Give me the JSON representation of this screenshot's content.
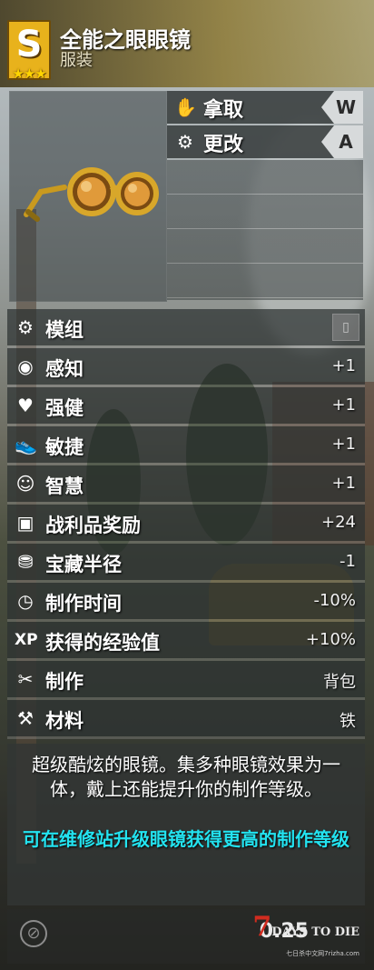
{
  "item": {
    "tier_letter": "S",
    "tier_stars": "★★★",
    "name": "全能之眼眼镜",
    "category": "服装"
  },
  "actions": [
    {
      "label": "拿取",
      "key": "W",
      "icon": "hand-grab-icon"
    },
    {
      "label": "更改",
      "key": "A",
      "icon": "gears-icon"
    }
  ],
  "stats": [
    {
      "label": "模组",
      "value": "",
      "icon": "gear-icon"
    },
    {
      "label": "感知",
      "value": "+1",
      "icon": "eye-icon"
    },
    {
      "label": "强健",
      "value": "+1",
      "icon": "heart-icon"
    },
    {
      "label": "敏捷",
      "value": "+1",
      "icon": "shoe-icon"
    },
    {
      "label": "智慧",
      "value": "+1",
      "icon": "brain-icon"
    },
    {
      "label": "战利品奖励",
      "value": "+24",
      "icon": "crate-icon"
    },
    {
      "label": "宝藏半径",
      "value": "-1",
      "icon": "treasure-icon"
    },
    {
      "label": "制作时间",
      "value": "-10%",
      "icon": "stopwatch-icon"
    },
    {
      "label": "获得的经验值",
      "value": "+10%",
      "icon": "xp-icon"
    },
    {
      "label": "制作",
      "value": "背包",
      "icon": "tools-icon"
    },
    {
      "label": "材料",
      "value": "铁",
      "icon": "materials-icon"
    }
  ],
  "description": {
    "main": "超级酷炫的眼镜。集多种眼镜效果为一体，戴上还能提升你的制作等级。",
    "tip": "可在维修站升级眼镜获得更高的制作等级"
  },
  "footer": {
    "weight": "0.25",
    "icon": "no-durability-icon",
    "watermark_brand": "DAYS TO DIE",
    "watermark_number": "7",
    "watermark_sub": "七日杀中文网7rizha.com"
  },
  "colors": {
    "tier_badge": "#e8b21c",
    "tip_text": "#23e3f0"
  }
}
